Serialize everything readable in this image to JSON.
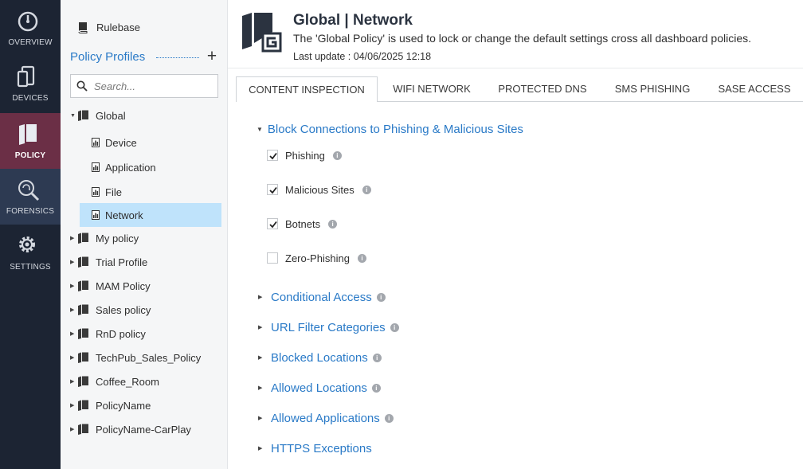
{
  "nav": {
    "items": [
      {
        "label": "OVERVIEW",
        "icon": "speedometer-icon"
      },
      {
        "label": "DEVICES",
        "icon": "devices-icon"
      },
      {
        "label": "POLICY",
        "icon": "policy-book-icon"
      },
      {
        "label": "FORENSICS",
        "icon": "forensics-fingerprint-icon"
      },
      {
        "label": "SETTINGS",
        "icon": "gear-icon"
      }
    ],
    "active": "POLICY"
  },
  "sidebar": {
    "rulebase_label": "Rulebase",
    "profiles_title": "Policy Profiles",
    "add_label": "+",
    "search": {
      "placeholder": "Search...",
      "value": ""
    },
    "tree": [
      {
        "label": "Global",
        "expanded": true,
        "children": [
          "Device",
          "Application",
          "File",
          "Network"
        ],
        "selected_child": "Network"
      },
      {
        "label": "My policy"
      },
      {
        "label": "Trial Profile"
      },
      {
        "label": "MAM Policy"
      },
      {
        "label": "Sales policy"
      },
      {
        "label": "RnD policy"
      },
      {
        "label": "TechPub_Sales_Policy"
      },
      {
        "label": "Coffee_Room"
      },
      {
        "label": "PolicyName"
      },
      {
        "label": "PolicyName-CarPlay"
      }
    ]
  },
  "header": {
    "title": "Global |  Network",
    "description": "The 'Global Policy' is used to lock or change the default settings cross all dashboard policies.",
    "last_update": "Last update : 04/06/2025 12:18"
  },
  "tabs": [
    {
      "label": "CONTENT INSPECTION",
      "active": true
    },
    {
      "label": "WIFI NETWORK",
      "active": false
    },
    {
      "label": "PROTECTED DNS",
      "active": false
    },
    {
      "label": "SMS PHISHING",
      "active": false
    },
    {
      "label": "SASE ACCESS",
      "active": false
    }
  ],
  "main": {
    "expanded_section": {
      "title": "Block Connections to Phishing & Malicious Sites",
      "options": [
        {
          "label": "Phishing",
          "checked": true
        },
        {
          "label": "Malicious Sites",
          "checked": true
        },
        {
          "label": "Botnets",
          "checked": true
        },
        {
          "label": "Zero-Phishing",
          "checked": false
        }
      ]
    },
    "collapsed_sections": [
      {
        "title": "Conditional Access",
        "info": true
      },
      {
        "title": "URL Filter Categories",
        "info": true
      },
      {
        "title": "Blocked Locations",
        "info": true
      },
      {
        "title": "Allowed Locations",
        "info": true
      },
      {
        "title": "Allowed Applications",
        "info": true
      },
      {
        "title": "HTTPS Exceptions",
        "info": false
      }
    ]
  },
  "colors": {
    "nav_bg": "#1c2433",
    "nav_active": "#6b2f46",
    "accent_blue": "#2a7ac7",
    "selected_row": "#bfe3fb"
  }
}
